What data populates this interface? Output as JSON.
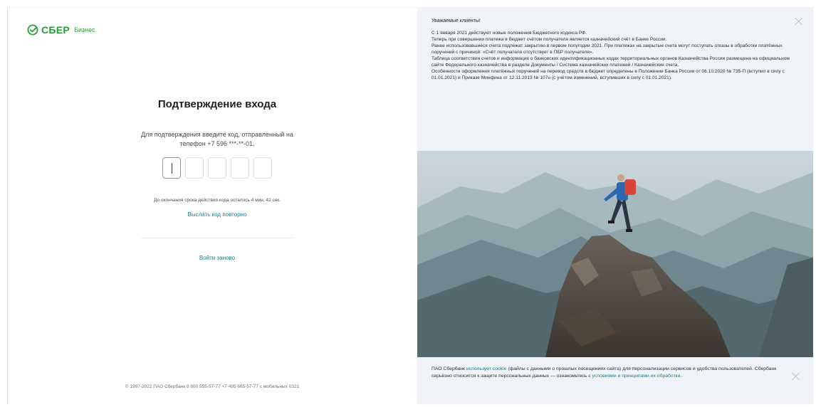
{
  "brand": {
    "name": "СБЕР",
    "product": "Бизнес",
    "color": "#21a038"
  },
  "auth": {
    "title": "Подтверждение входа",
    "hint": "Для подтверждения введите код, отправленный на телефон +7 596 ***-**-01.",
    "code_cells": 5,
    "timer": "До окончания срока действия кода осталось 4 мин. 42 сек.",
    "resend_label": "Выслать код повторно",
    "relogin_label": "Войти заново"
  },
  "footer": {
    "text": "© 1997-2022  ПАО Сбербанк  8 800 555-57-77  +7 495 665-57-77  с мобильных 0321"
  },
  "notice": {
    "title": "Уважаемые клиенты!",
    "paragraphs": [
      "С 1 января 2021 действуют новые положения Бюджетного кодекса РФ.",
      "Теперь при совершении платежа в бюджет счётом получателя является казначейский счёт в Банке России.",
      "Ранее использовавшиеся счета подлежат закрытию в первом полугодии 2021. При платежах на закрытые счета могут поступать отказы в обработке платёжных поручений с причиной: «Счёт получателя отсутствует в ПБР получателя».",
      "Таблица соответствия счетов и информация о банковских идентификационных кодах территориальных органов Казначейства России размещена на официальном сайте Федерального казначейства в разделе Документы / Система казначейских платежей / Казначейские счета.",
      "Особенности оформления платёжных поручений на перевод средств в бюджет определены в Положении Банка России от 06.10.2020 № 735-П (вступил в силу с 01.01.2021) и Приказе Минфина от 12.11.2013 № 107н (с учётом изменений, вступивших в силу с 01.01.2021)."
    ]
  },
  "cookie": {
    "part1": "ПАО Сбербанк ",
    "link1": "использует cookie",
    "part2": " (файлы с данными о прошлых посещениях сайта) для персонализации сервисов и удобства пользователей. Сбербанк серьёзно относится к защите персональных данных — ознакомьтесь с ",
    "link2": "условиями и принципами их обработки",
    "part3": "."
  },
  "colors": {
    "link": "#107f8c",
    "notice_bg": "#f0f4f9"
  }
}
